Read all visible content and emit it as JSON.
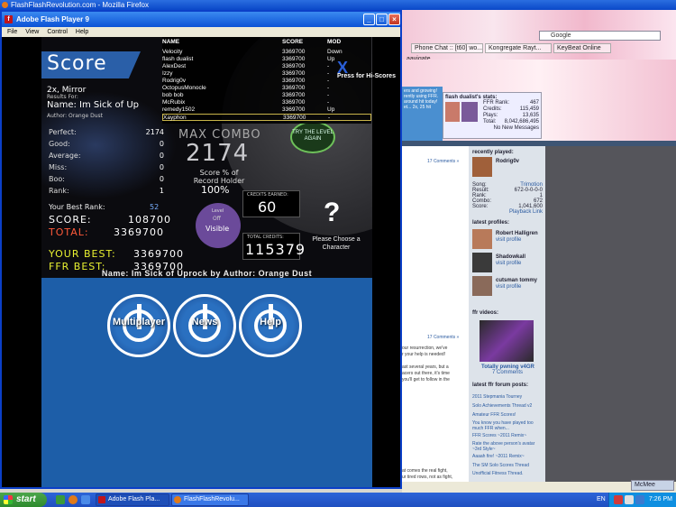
{
  "firefox": {
    "title": "FlashFlashRevolution.com - Mozilla Firefox",
    "tabs": [
      "Phone Chat :: [t60] wo...",
      "Kongregate Rayt...",
      "KeyBeat Online",
      "aavigate"
    ],
    "search_placeholder": "Google",
    "stats": {
      "title": "flash dualist's stats:",
      "rows": [
        {
          "k": "FFR Rank:",
          "v": "467"
        },
        {
          "k": "Credits:",
          "v": "115,459"
        },
        {
          "k": "Plays:",
          "v": "13,635"
        },
        {
          "k": "Total:",
          "v": "8,042,686,495"
        },
        {
          "k": "",
          "v": "No New Messages"
        }
      ]
    },
    "banner_lines": [
      "ers and growing!",
      "rently using FFR.",
      "around hit today!",
      "et... 2x, 25 hit"
    ],
    "content_lines": [
      {
        "t": "17 Comments »",
        "link": true
      },
      {
        "t": "17 Comments »",
        "link": true
      },
      {
        "t": "our resurrection, we've",
        "link": false
      },
      {
        "t": "r your help is needed!",
        "link": false
      },
      {
        "t": "ast several years, but a",
        "link": false
      },
      {
        "t": "acers out there, it's time",
        "link": false
      },
      {
        "t": "you'll get to follow in the",
        "link": false
      },
      {
        "t": "at comes the real fight,",
        "link": false
      },
      {
        "t": "ur tired rows, not as fight,",
        "link": false
      }
    ],
    "recently_played": {
      "heading": "recently played:",
      "user": "Rodrig0v",
      "rows": [
        {
          "k": "Song:",
          "v": "Trimotion"
        },
        {
          "k": "Result:",
          "v": "672-0-0-0-0"
        },
        {
          "k": "Rank:",
          "v": "1"
        },
        {
          "k": "Combo:",
          "v": "672"
        },
        {
          "k": "Score:",
          "v": "1,041,600"
        },
        {
          "k": "",
          "v": "Playback Link"
        }
      ]
    },
    "latest_profiles": {
      "heading": "latest profiles:",
      "items": [
        {
          "name": "Robert Halligren",
          "sub": "visit profile",
          "color": "#b87a5a"
        },
        {
          "name": "Shadowkall",
          "sub": "visit profile",
          "color": "#3a3a3a"
        },
        {
          "name": "cutsman tommy",
          "sub": "visit profile",
          "color": "#8a6a5a"
        }
      ]
    },
    "ffr_videos": {
      "heading": "ffr videos:",
      "caption": "Totally pwning v4GR",
      "sub": "7 Comments"
    },
    "forum_posts": {
      "heading": "latest ffr forum posts:",
      "items": [
        "2011 Stepmania Tourney",
        "Solo Achievements Thread v2",
        "Amateur FFR Scores!",
        "You know you have played too much FFR when...",
        "FFR Scores ~2011 Remix~",
        "Rate the above person's avatar ~3rd Style~",
        "Aaaah fire! ~2011 Remix~",
        "The SM Solo Scores Thread",
        "Unofficial Fitness Thread."
      ]
    }
  },
  "flash": {
    "title": "Adobe Flash Player 9",
    "menu": [
      "File",
      "View",
      "Control",
      "Help"
    ],
    "game": {
      "score_title": "Score",
      "mods": "2x, Mirror",
      "results_for": "Results For:",
      "song_name": "Name: Im Sick of Up",
      "author": "Author: Orange Dust",
      "judgements": [
        {
          "label": "Perfect:",
          "value": "2174"
        },
        {
          "label": "Good:",
          "value": "0"
        },
        {
          "label": "Average:",
          "value": "0"
        },
        {
          "label": "Miss:",
          "value": "0"
        },
        {
          "label": "Boo:",
          "value": "0"
        },
        {
          "label": "Rank:",
          "value": "1"
        }
      ],
      "max_combo_label": "MAX COMBO",
      "max_combo": "2174",
      "pct_label": "Score % of Record Holder",
      "pct_value": "100%",
      "try_again": "TRY THE LEVEL AGAIN",
      "best_rank_label": "Your Best Rank:",
      "best_rank": "52",
      "score_label": "SCORE:",
      "score_value": "108700",
      "total_label": "TOTAL:",
      "total_value": "3369700",
      "your_best_label": "YOUR BEST:",
      "your_best_value": "3369700",
      "ffr_best_label": "FFR BEST:",
      "ffr_best_value": "3369700",
      "level_label": "Level",
      "level_off": "Off",
      "level_visible": "Visible",
      "credits_earned_label": "CREDITS EARNED:",
      "credits_earned": "60",
      "total_credits_label": "TOTAL CREDITS:",
      "total_credits": "115379",
      "choose_char": "Please Choose a Character",
      "song_line": "Name: Im Sick of Uprock by Author: Orange Dust",
      "press_hi": "Press for Hi-Scores"
    },
    "leaderboard": {
      "headers": {
        "name": "NAME",
        "score": "SCORE",
        "mod": "MOD"
      },
      "rows": [
        {
          "name": "Velocity",
          "score": "3369700",
          "mod": "Down"
        },
        {
          "name": "flash dualist",
          "score": "3369700",
          "mod": "Up"
        },
        {
          "name": "AlexDest",
          "score": "3369700",
          "mod": "-"
        },
        {
          "name": "Izzy",
          "score": "3369700",
          "mod": "-"
        },
        {
          "name": "Rodrig0v",
          "score": "3369700",
          "mod": "-"
        },
        {
          "name": "OctopusMonocle",
          "score": "3369700",
          "mod": "-"
        },
        {
          "name": "bob bob",
          "score": "3369700",
          "mod": "-"
        },
        {
          "name": "McRubix",
          "score": "3369700",
          "mod": "-"
        },
        {
          "name": "remedy1502",
          "score": "3369700",
          "mod": "Up"
        },
        {
          "name": "Xayphon",
          "score": "3369700",
          "mod": "-"
        }
      ]
    },
    "menu_buttons": [
      "Multiplayer",
      "News",
      "Help"
    ]
  },
  "taskbar": {
    "start": "start",
    "tasks": [
      "Adobe Flash Pla...",
      "FlashFlashRevolu..."
    ],
    "lang": "EN",
    "time": "7:26 PM",
    "mcmee": "McMee"
  }
}
